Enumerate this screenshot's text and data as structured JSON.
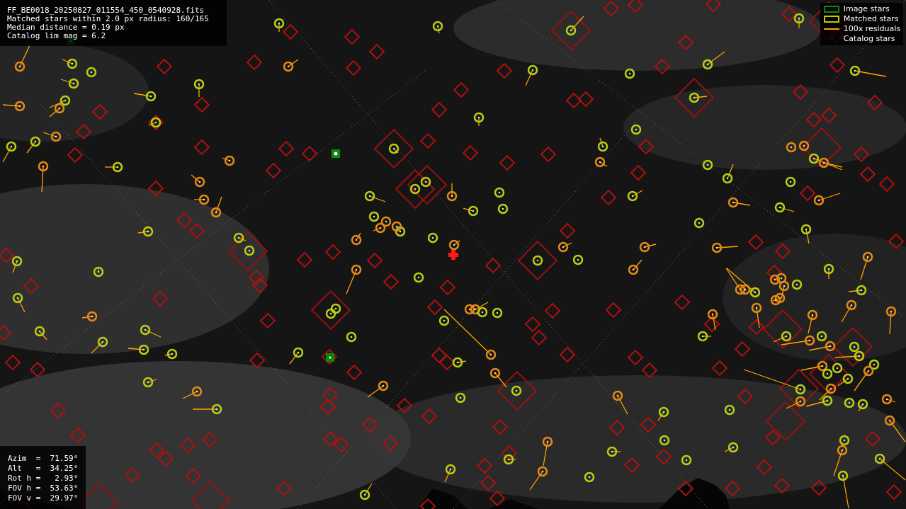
{
  "info": {
    "lines": [
      "FF_BE0018_20250827_011554_450_0540928.fits",
      "Matched stars within 2.0 px radius: 160/165",
      "Median distance = 0.19 px",
      "Catalog lim mag = 6.2"
    ]
  },
  "legend": [
    {
      "kind": "box",
      "color": "#0a8a0a",
      "label": "Image stars"
    },
    {
      "kind": "box",
      "color": "#c8c800",
      "label": "Matched stars"
    },
    {
      "kind": "line",
      "color": "#ffa500",
      "label": "100x residuals"
    },
    {
      "kind": "blank",
      "label": "Catalog stars"
    }
  ],
  "pointing": {
    "lines": [
      "Azim  =  71.59°",
      "Alt   =  34.25°",
      "Rot h =   2.93°",
      "FOV h =  53.63°",
      "FOV v =  29.97°"
    ]
  }
}
